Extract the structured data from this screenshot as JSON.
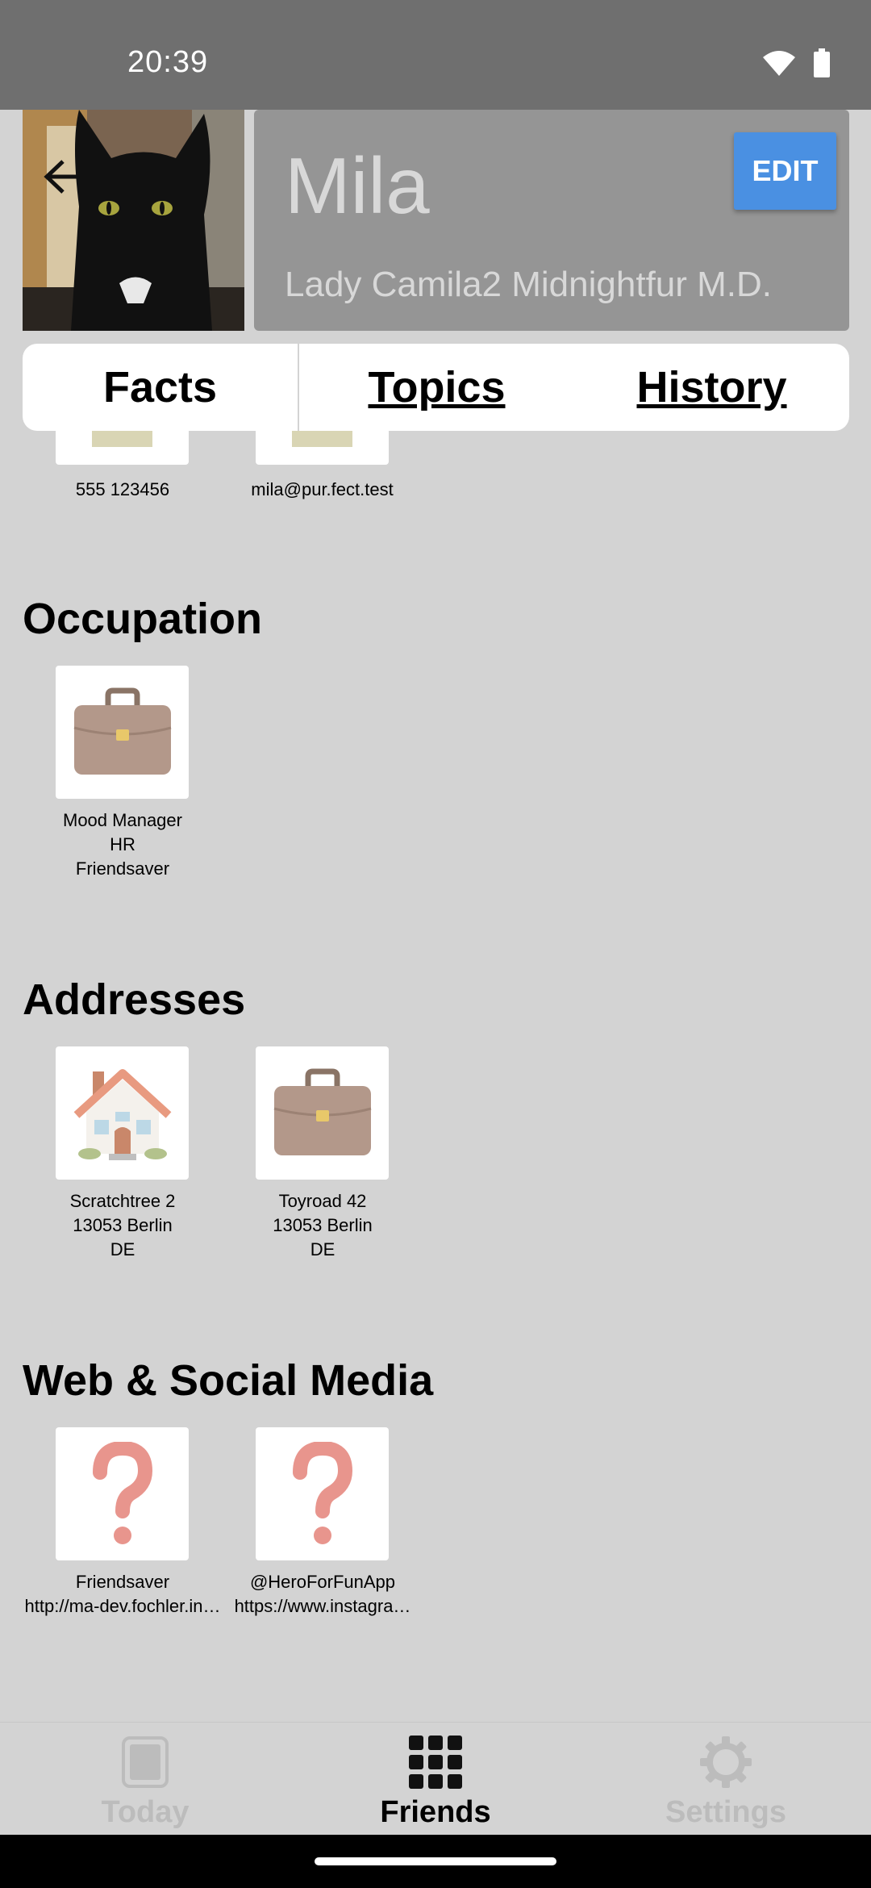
{
  "status": {
    "time": "20:39"
  },
  "header": {
    "name": "Mila",
    "full_name": "Lady Camila2 Midnightfur M.D.",
    "edit_label": "EDIT"
  },
  "tabs": [
    {
      "label": "Facts",
      "active": true
    },
    {
      "label": "Topics"
    },
    {
      "label": "History"
    }
  ],
  "contacts": [
    {
      "text": "555 123456"
    },
    {
      "text": "mila@pur.fect.test"
    }
  ],
  "occupation": {
    "title": "Occupation",
    "items": [
      {
        "icon": "briefcase-icon",
        "lines": [
          "Mood Manager",
          "HR",
          "Friendsaver"
        ]
      }
    ]
  },
  "addresses": {
    "title": "Addresses",
    "items": [
      {
        "icon": "house-icon",
        "lines": [
          "Scratchtree 2",
          "13053 Berlin",
          "DE"
        ]
      },
      {
        "icon": "briefcase-icon",
        "lines": [
          "Toyroad 42",
          "13053 Berlin",
          "DE"
        ]
      }
    ]
  },
  "web": {
    "title": "Web & Social Media",
    "items": [
      {
        "icon": "question-icon",
        "lines": [
          "Friendsaver",
          "http://ma-dev.fochler.in…"
        ]
      },
      {
        "icon": "question-icon",
        "lines": [
          "@HeroForFunApp",
          "https://www.instagra…"
        ]
      }
    ]
  },
  "nav": [
    {
      "label": "Today",
      "icon": "tablet-icon",
      "active": false
    },
    {
      "label": "Friends",
      "icon": "grid-icon",
      "active": true
    },
    {
      "label": "Settings",
      "icon": "gear-icon",
      "active": false
    }
  ]
}
